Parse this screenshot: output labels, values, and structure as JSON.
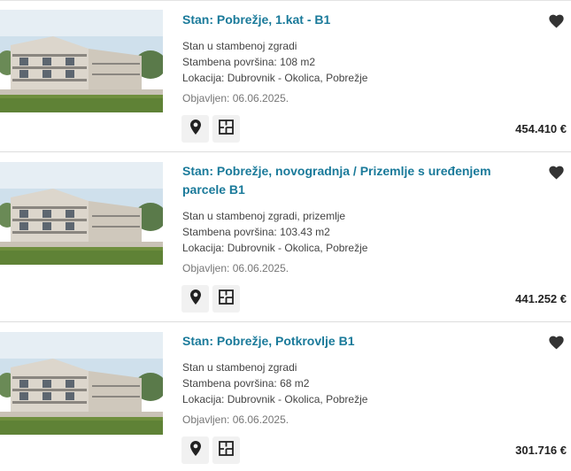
{
  "listings": [
    {
      "title": "Stan: Pobrežje, 1.kat - B1",
      "details": [
        "Stan u stambenoj zgradi",
        "Stambena površina: 108 m2",
        "Lokacija: Dubrovnik - Okolica, Pobrežje"
      ],
      "published": "Objavljen: 06.06.2025.",
      "price": "454.410 €"
    },
    {
      "title": "Stan: Pobrežje, novogradnja / Prizemlje s uređenjem parcele B1",
      "details": [
        "Stan u stambenoj zgradi, prizemlje",
        "Stambena površina: 103.43 m2",
        "Lokacija: Dubrovnik - Okolica, Pobrežje"
      ],
      "published": "Objavljen: 06.06.2025.",
      "price": "441.252 €"
    },
    {
      "title": "Stan: Pobrežje, Potkrovlje B1",
      "details": [
        "Stan u stambenoj zgradi",
        "Stambena površina: 68 m2",
        "Lokacija: Dubrovnik - Okolica, Pobrežje"
      ],
      "published": "Objavljen: 06.06.2025.",
      "price": "301.716 €"
    }
  ],
  "icons": {
    "favorite": "heart-icon",
    "map": "map-pin-icon",
    "floorplan": "floorplan-icon"
  },
  "colors": {
    "title": "#1a7a9a",
    "icon_button_bg": "#f1f1f1"
  }
}
